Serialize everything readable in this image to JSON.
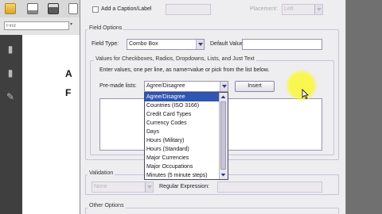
{
  "find": {
    "placeholder": "Find"
  },
  "doc": {
    "letters": [
      "A",
      "F"
    ]
  },
  "dialog": {
    "caption_checkbox_label": "Add a Caption/Label",
    "placement_label": "Placement:",
    "placement_value": "Left",
    "field_options_title": "Field Options",
    "field_type_label": "Field Type:",
    "field_type_value": "Combo Box",
    "default_value_label": "Default Value:",
    "values_group_title": "Values for Checkboxes, Radios, Dropdowns, Lists, and Just Text",
    "instructions": "Enter values, one per line, as name=value or pick from the list below.",
    "premade_label": "Pre-made lists:",
    "premade_value": "Agree/Disagree",
    "insert_button": "Insert",
    "premade_options": [
      "Agree/Disagree",
      "Countries (ISO 3166)",
      "Credit Card Types",
      "Currency Codes",
      "Days",
      "Hours (Military)",
      "Hours (Standard)",
      "Major Currencies",
      "Major Occupations",
      "Minutes (5 minute steps)"
    ],
    "selected_index": 0,
    "validation_title": "Validation",
    "validation_value": "None",
    "regex_label": "Regular Expression:",
    "other_options_title": "Other Options"
  },
  "icons": [
    "folder-icon",
    "print-icon",
    "save-icon",
    "document-icon",
    "page-icon",
    "sign-icon",
    "cursor-icon"
  ]
}
